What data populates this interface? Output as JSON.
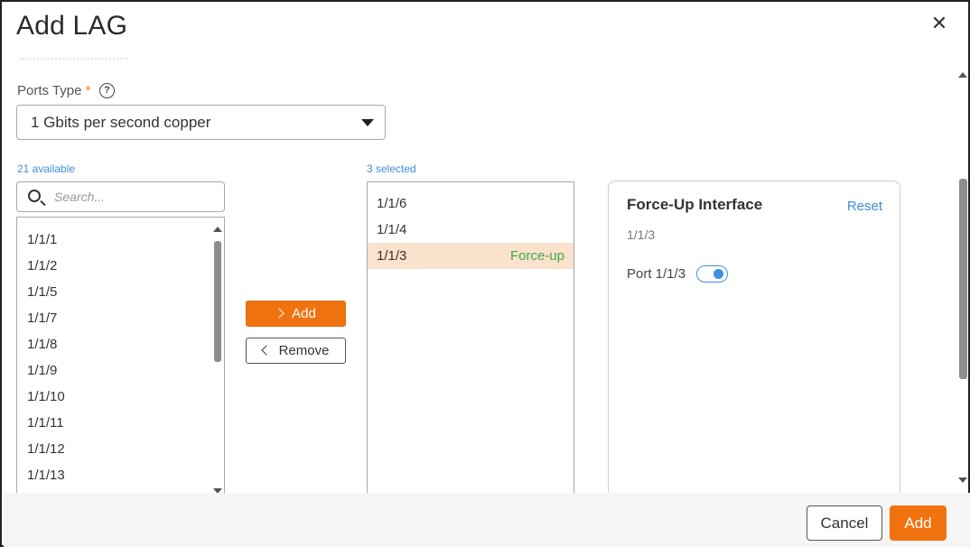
{
  "dialog": {
    "title": "Add LAG",
    "close_icon": "close-icon"
  },
  "ports_type": {
    "label": "Ports Type",
    "required_mark": "*",
    "help_icon": "question-circle-icon",
    "help_glyph": "?",
    "selected": "1 Gbits per second copper"
  },
  "available": {
    "count_label": "21 available",
    "search_placeholder": "Search...",
    "items": [
      "1/1/1",
      "1/1/2",
      "1/1/5",
      "1/1/7",
      "1/1/8",
      "1/1/9",
      "1/1/10",
      "1/1/11",
      "1/1/12",
      "1/1/13"
    ]
  },
  "transfer": {
    "add_label": "Add",
    "remove_label": "Remove"
  },
  "selected": {
    "count_label": "3 selected",
    "items": [
      {
        "port": "1/1/6",
        "tag": ""
      },
      {
        "port": "1/1/4",
        "tag": ""
      },
      {
        "port": "1/1/3",
        "tag": "Force-up",
        "highlighted": true
      }
    ]
  },
  "force_up": {
    "title": "Force-Up Interface",
    "reset_label": "Reset",
    "port": "1/1/3",
    "toggle_label": "Port 1/1/3",
    "toggle_on": true
  },
  "footer": {
    "cancel_label": "Cancel",
    "add_label": "Add"
  },
  "colors": {
    "accent": "#f07310",
    "link": "#3d8ee0",
    "force_up_text": "#3ea84a",
    "highlight_row": "#fbe2cd"
  }
}
